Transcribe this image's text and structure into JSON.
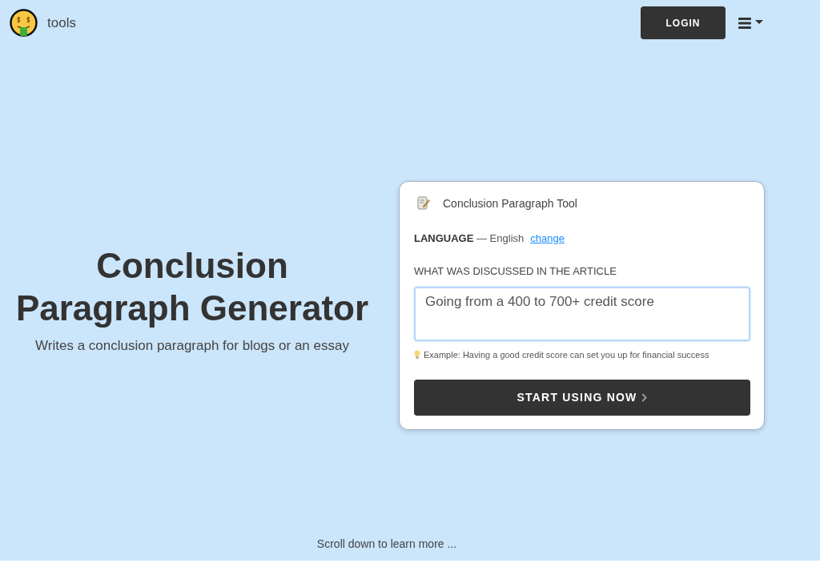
{
  "header": {
    "brand": "tools",
    "login_button": "LOGIN"
  },
  "hero": {
    "title": "Conclusion Paragraph Generator",
    "subtitle": "Writes a conclusion paragraph for blogs or an essay"
  },
  "tool_card": {
    "title": "Conclusion Paragraph Tool",
    "language": {
      "text": "**LANGUAGE** — English",
      "link": "change"
    },
    "field": {
      "label": "WHAT WAS DISCUSSED IN THE ARTICLE",
      "value": "Going from a 400 to 700+ credit score"
    },
    "hint": "Example: Having a good credit score can set you up for financial success",
    "submit_button": "START USING NOW"
  },
  "footer_hint": "Scroll down to learn more ..."
}
